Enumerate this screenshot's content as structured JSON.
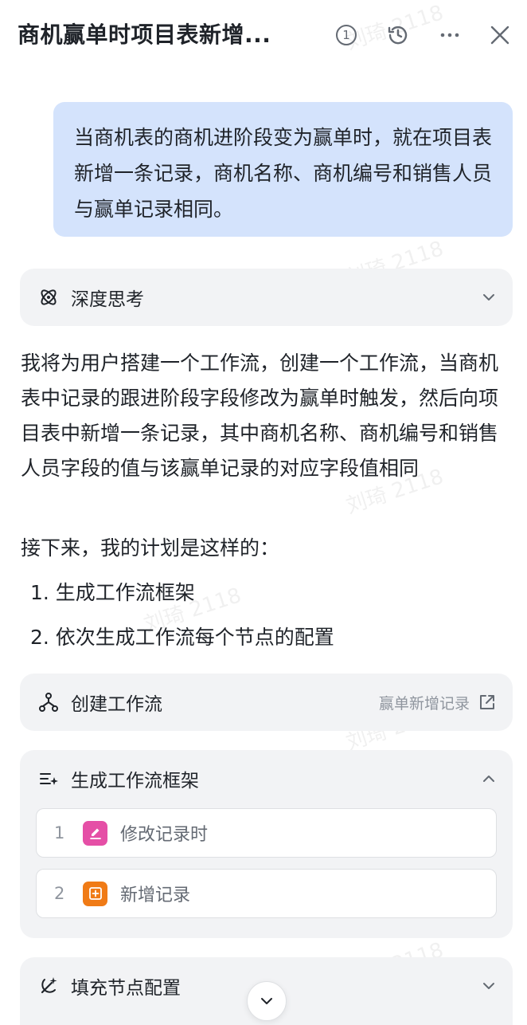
{
  "header": {
    "title": "商机赢单时项目表新增...",
    "count_badge": "1"
  },
  "user_message": "当商机表的商机进阶段变为赢单时，就在项目表新增一条记录，商机名称、商机编号和销售人员与赢单记录相同。",
  "deep_think": {
    "label": "深度思考"
  },
  "reply": {
    "paragraph": "我将为用户搭建一个工作流，创建一个工作流，当商机表中记录的跟进阶段字段修改为赢单时触发，然后向项目表中新增一条记录，其中商机名称、商机编号和销售人员字段的值与该赢单记录的对应字段值相同",
    "plan_intro": "接下来，我的计划是这样的：",
    "plan": [
      "1. 生成工作流框架",
      "2. 依次生成工作流每个节点的配置"
    ]
  },
  "create_workflow": {
    "label": "创建工作流",
    "link_text": "赢单新增记录"
  },
  "framework": {
    "label": "生成工作流框架",
    "steps": [
      {
        "num": "1",
        "label": "修改记录时",
        "color": "#e54fa6",
        "icon": "edit-icon"
      },
      {
        "num": "2",
        "label": "新增记录",
        "color": "#f07b16",
        "icon": "plus-icon"
      }
    ]
  },
  "fill_config": {
    "label": "填充节点配置"
  },
  "watermark": "刘琦 2118"
}
